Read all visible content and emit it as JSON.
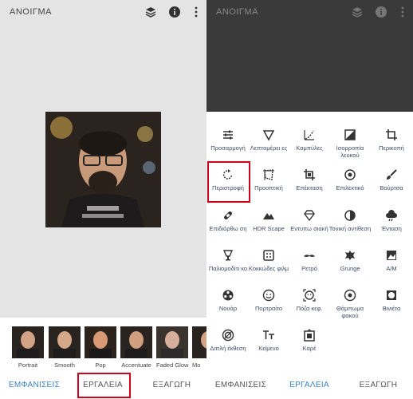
{
  "left": {
    "title": "ΑΝΟΙΓΜΑ",
    "looks": [
      {
        "label": "Portrait"
      },
      {
        "label": "Smooth"
      },
      {
        "label": "Pop"
      },
      {
        "label": "Accentuate"
      },
      {
        "label": "Faded Glow"
      },
      {
        "label": "Mo"
      }
    ],
    "tabs": [
      "ΕΜΦΑΝΙΣΕΙΣ",
      "ΕΡΓΑΛΕΙΑ",
      "ΕΞΑΓΩΓΗ"
    ],
    "active_tab": "ΕΜΦΑΝΙΣΕΙΣ"
  },
  "right": {
    "title": "ΑΝΟΙΓΜΑ",
    "tools": [
      {
        "label": "Προσαρμογή",
        "icon": "tune-icon"
      },
      {
        "label": "Λεπτομέρει ες",
        "icon": "details-icon"
      },
      {
        "label": "Καμπύλες",
        "icon": "curves-icon"
      },
      {
        "label": "Ισορροπία λευκού",
        "icon": "white-balance-icon"
      },
      {
        "label": "Περικοπή",
        "icon": "crop-icon"
      },
      {
        "label": "Περιστροφή",
        "icon": "rotate-icon"
      },
      {
        "label": "Προοπτική",
        "icon": "perspective-icon"
      },
      {
        "label": "Επέκταση",
        "icon": "expand-icon"
      },
      {
        "label": "Επιλεκτικό",
        "icon": "selective-icon"
      },
      {
        "label": "Βούρτσα",
        "icon": "brush-icon"
      },
      {
        "label": "Επιδιόρθω ση",
        "icon": "healing-icon"
      },
      {
        "label": "HDR Scape",
        "icon": "hdr-icon"
      },
      {
        "label": "Εντυπω σιακή",
        "icon": "glamour-icon"
      },
      {
        "label": "Τονική αντίθεση",
        "icon": "tonal-contrast-icon"
      },
      {
        "label": "Ένταση",
        "icon": "drama-icon"
      },
      {
        "label": "Παλιομοδίτι κο",
        "icon": "vintage-icon"
      },
      {
        "label": "Κοκκώδες φιλμ",
        "icon": "grainy-film-icon"
      },
      {
        "label": "Ρετρό",
        "icon": "retrolux-icon"
      },
      {
        "label": "Grunge",
        "icon": "grunge-icon"
      },
      {
        "label": "A/M",
        "icon": "black-white-icon"
      },
      {
        "label": "Νουάρ",
        "icon": "noir-icon"
      },
      {
        "label": "Πορτραίτο",
        "icon": "portrait-icon"
      },
      {
        "label": "Πόζα κεφ.",
        "icon": "head-pose-icon"
      },
      {
        "label": "Θάμπωμα φακού",
        "icon": "lens-blur-icon"
      },
      {
        "label": "Βινιέτα",
        "icon": "vignette-icon"
      },
      {
        "label": "Διπλή έκθεση",
        "icon": "double-exposure-icon"
      },
      {
        "label": "Κείμενο",
        "icon": "text-icon"
      },
      {
        "label": "Καρέ",
        "icon": "frames-icon"
      }
    ],
    "tabs": [
      "ΕΜΦΑΝΙΣΕΙΣ",
      "ΕΡΓΑΛΕΙΑ",
      "ΕΞΑΓΩΓΗ"
    ],
    "active_tab": "ΕΡΓΑΛΕΙΑ"
  },
  "colors": {
    "accent": "#3b82c4",
    "highlight": "#d0021b",
    "tool_label": "#3d4a66"
  },
  "icons": [
    "stack-icon",
    "info-icon",
    "more-vert-icon"
  ]
}
